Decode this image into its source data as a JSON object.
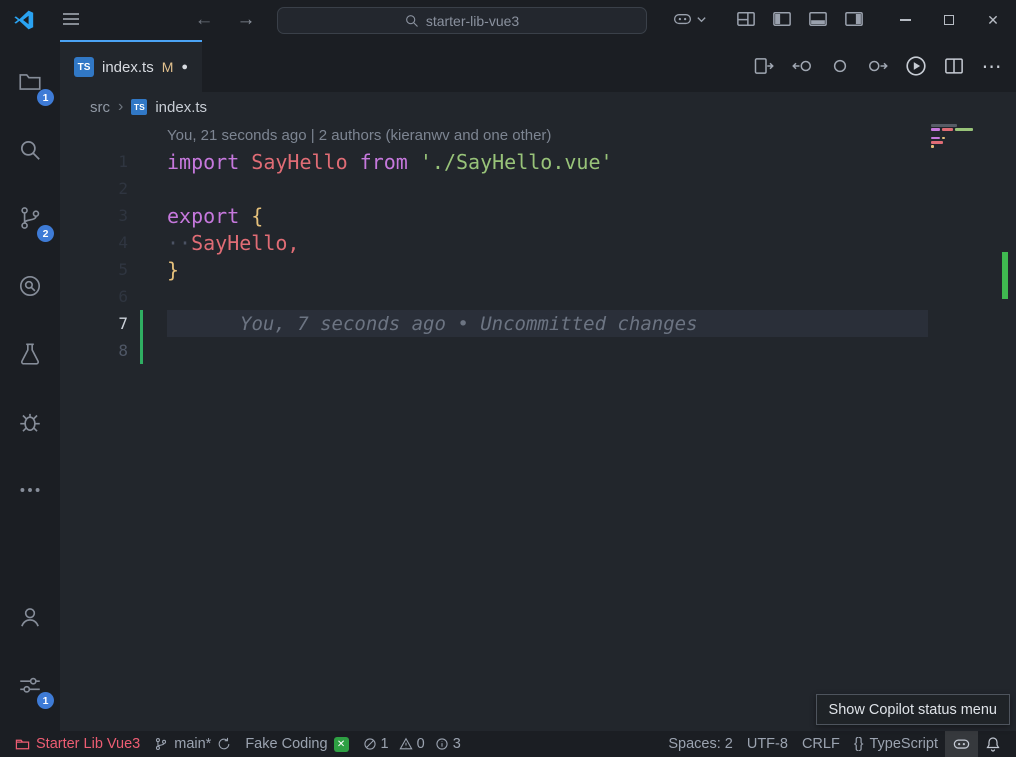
{
  "titlebar": {
    "search_value": "starter-lib-vue3"
  },
  "activity_bar": {
    "explorer_badge": "1",
    "scm_badge": "2",
    "manage_badge": "1"
  },
  "tab_bar": {
    "tab_label": "index.ts",
    "git_status": "M",
    "ts_badge": "TS"
  },
  "breadcrumb": {
    "dir": "src",
    "file": "index.ts",
    "file_icon": "TS"
  },
  "editor": {
    "codelens": "You, 21 seconds ago | 2 authors (kieranwv and one other)",
    "lines": [
      {
        "num": "1",
        "tokens": [
          [
            "import",
            "kw"
          ],
          [
            " ",
            "pl"
          ],
          [
            "SayHello",
            "id"
          ],
          [
            " ",
            "pl"
          ],
          [
            "from",
            "kw"
          ],
          [
            " ",
            "pl"
          ],
          [
            "'./SayHello.vue'",
            "str"
          ]
        ]
      },
      {
        "num": "2",
        "tokens": []
      },
      {
        "num": "3",
        "tokens": [
          [
            "export",
            "kw"
          ],
          [
            " ",
            "pl"
          ],
          [
            "{",
            "br"
          ]
        ]
      },
      {
        "num": "4",
        "tokens": [
          [
            "·",
            "ws"
          ],
          [
            "·",
            "ws"
          ],
          [
            "SayHello",
            "id"
          ],
          [
            ",",
            "id"
          ]
        ]
      },
      {
        "num": "5",
        "tokens": [
          [
            "}",
            "br"
          ]
        ]
      },
      {
        "num": "6",
        "tokens": []
      },
      {
        "num": "7",
        "tokens": [],
        "current": true,
        "changed": true,
        "num_class": "active",
        "blame": "You, 7 seconds ago • Uncommitted changes"
      },
      {
        "num": "8",
        "tokens": [],
        "changed": true,
        "num_class": "mid"
      }
    ],
    "minimap": [
      [
        [
          26,
          "cm"
        ]
      ],
      [
        [
          9,
          "kw"
        ],
        [
          11,
          "id"
        ],
        [
          18,
          "str"
        ]
      ],
      [],
      [
        [
          9,
          "kw"
        ],
        [
          3,
          "br"
        ]
      ],
      [
        [
          12,
          "id"
        ]
      ],
      [
        [
          3,
          "br"
        ]
      ]
    ]
  },
  "status_bar": {
    "workspace": "Starter Lib Vue3",
    "branch": "main*",
    "task": "Fake Coding",
    "errors": "1",
    "warnings": "0",
    "infos": "3",
    "indent": "Spaces: 2",
    "encoding": "UTF-8",
    "eol": "CRLF",
    "language_icon": "{}",
    "language": "TypeScript"
  },
  "tooltip": "Show Copilot status menu",
  "colors": {
    "accent_blue": "#4ba3f5",
    "badge_blue": "#3e7bd6",
    "added_green": "#2fae62",
    "workspace_red": "#ee5d73",
    "keyword": "#c678dd",
    "identifier": "#e06c75",
    "string": "#98c379",
    "brace": "#e5c07b"
  }
}
